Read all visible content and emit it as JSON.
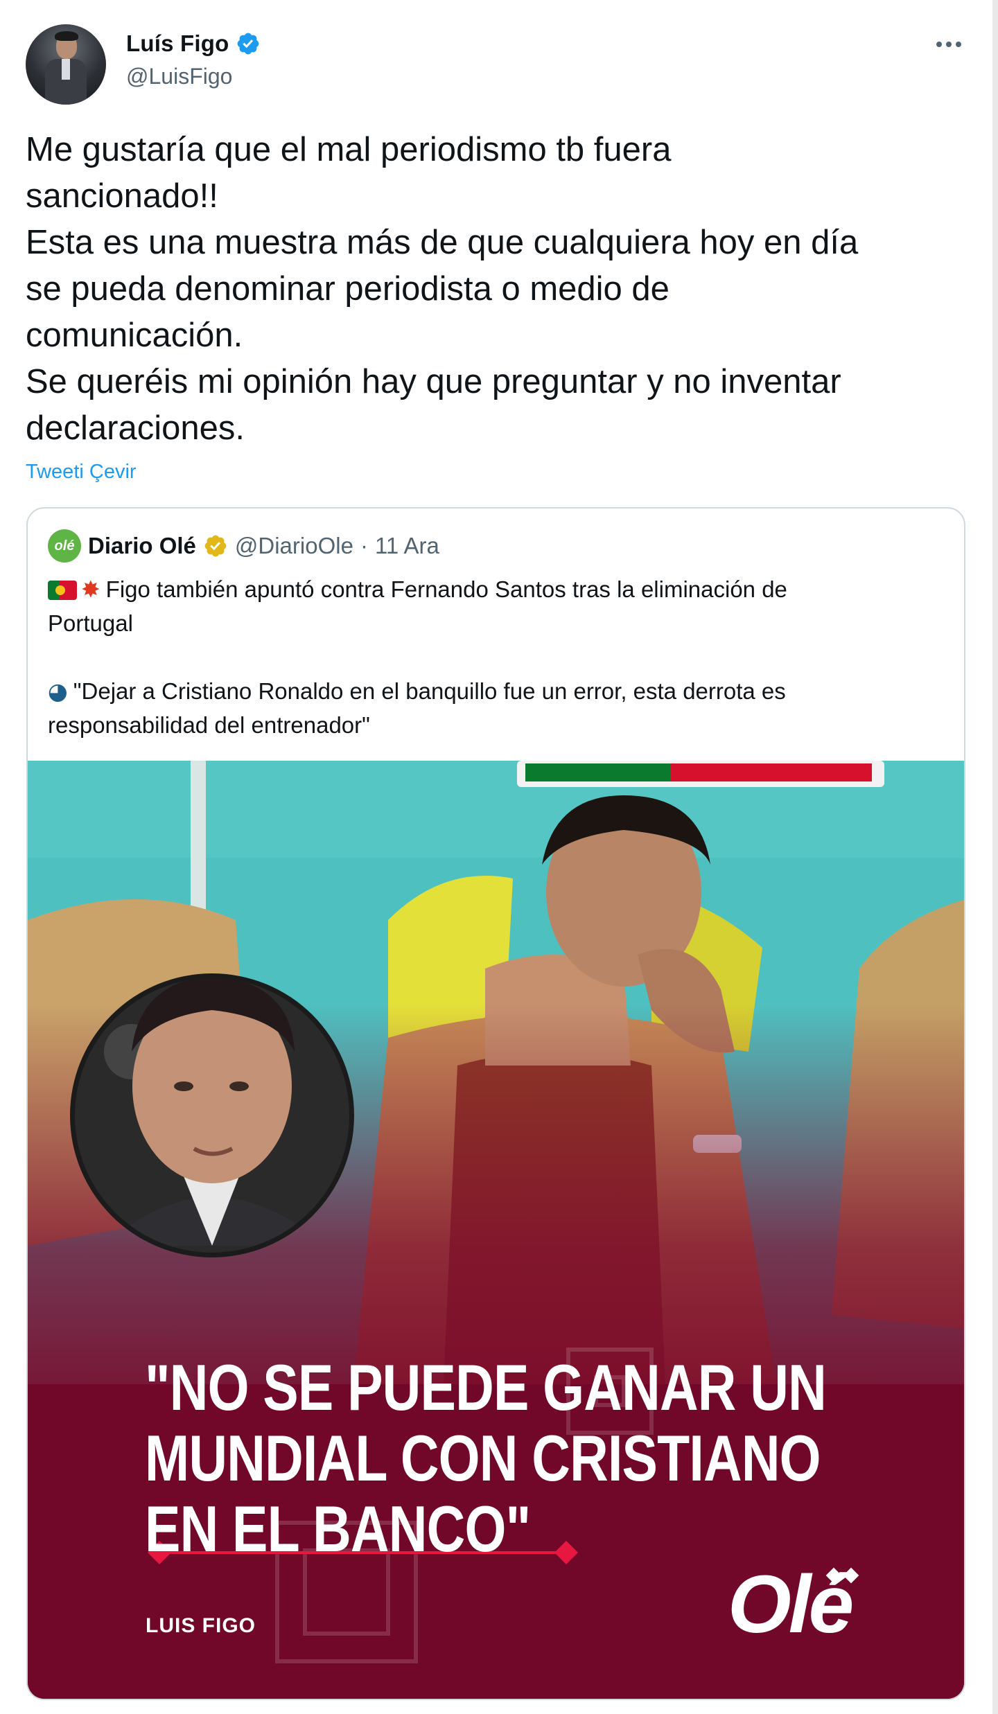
{
  "tweet": {
    "author_name": "Luís Figo",
    "author_handle": "@LuisFigo",
    "verified": true,
    "text_lines": [
      "Me gustaría que el mal periodismo tb fuera",
      "sancionado!!",
      "Esta es una muestra más de que cualquiera hoy en día",
      "se pueda denominar periodista o medio de",
      "comunicación.",
      "Se queréis mi opinión hay que preguntar y no inventar",
      "declaraciones."
    ],
    "translate_label": "Tweeti Çevir"
  },
  "quoted": {
    "author_name": "Diario Olé",
    "author_handle": "@DiarioOle",
    "separator": "·",
    "date": "11 Ara",
    "logo_text": "olé",
    "text_line_1": "Figo también apuntó contra Fernando Santos tras la eliminación de",
    "text_line_2": "Portugal",
    "quote_line_1": "\"Dejar a Cristiano Ronaldo en el banquillo fue un error, esta derrota es",
    "quote_line_2": "responsabilidad del entrenador\"",
    "emoji_1": "portugal-flag",
    "emoji_2": "collision",
    "emoji_3": "speaking-head",
    "media": {
      "headline_lines": [
        "\"NO SE PUEDE GANAR UN",
        "MUNDIAL CON CRISTIANO",
        "EN EL BANCO\""
      ],
      "attribution": "LUIS FIGO",
      "brand_logo": "Olé"
    }
  },
  "colors": {
    "link": "#1d9bf0",
    "secondary_text": "#536471",
    "verified_blue": "#1d9bf0",
    "verified_gold": "#e2b719",
    "maroon_overlay": "#7d0b2e",
    "pitch_teal": "#4fc0c0",
    "accent_red": "#e8173f"
  }
}
